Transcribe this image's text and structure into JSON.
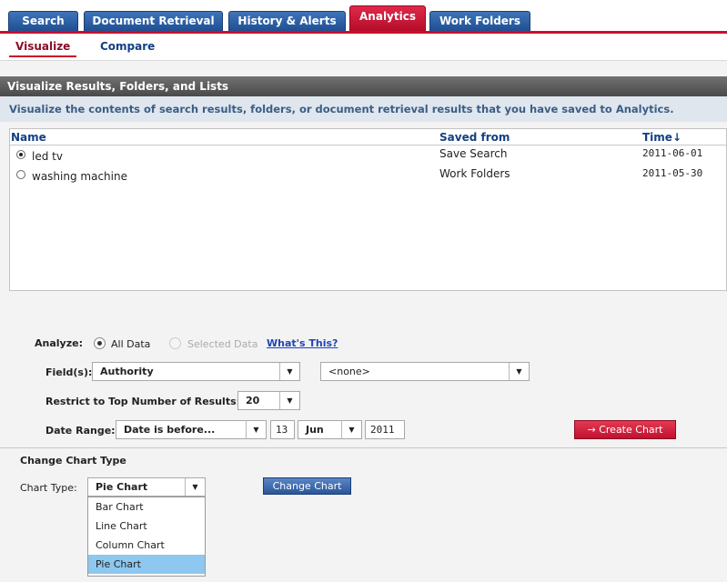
{
  "tabs": [
    {
      "label": "Search"
    },
    {
      "label": "Document Retrieval"
    },
    {
      "label": "History & Alerts"
    },
    {
      "label": "Analytics"
    },
    {
      "label": "Work Folders"
    }
  ],
  "subnav": {
    "visualize": "Visualize",
    "compare": "Compare"
  },
  "panel": {
    "title": "Visualize Results, Folders, and Lists",
    "description": "Visualize the contents of search results, folders, or document retrieval results that you have saved to Analytics."
  },
  "list": {
    "columns": {
      "name": "Name",
      "saved_from": "Saved from",
      "time": "Time↓"
    },
    "rows": [
      {
        "name": "led tv",
        "saved_from": "Save Search",
        "time": "2011-06-01"
      },
      {
        "name": "washing machine",
        "saved_from": "Work Folders",
        "time": "2011-05-30"
      }
    ]
  },
  "analyze": {
    "label": "Analyze:",
    "all_data": "All Data",
    "selected_data": "Selected Data",
    "whats_this": "What's This?"
  },
  "fields": {
    "label": "Field(s):",
    "field1": "Authority",
    "field2": "<none>"
  },
  "restrict": {
    "label": "Restrict to Top Number of Results:",
    "value": "20"
  },
  "date_range": {
    "label": "Date Range:",
    "mode": "Date is before...",
    "day": "13",
    "month": "Jun",
    "year": "2011"
  },
  "create_chart": "→ Create Chart",
  "change_chart": {
    "heading": "Change Chart Type",
    "label": "Chart Type:",
    "selected": "Pie Chart",
    "button": "Change Chart",
    "options": [
      "Bar Chart",
      "Line Chart",
      "Column Chart",
      "Pie Chart"
    ]
  },
  "colors": {
    "brand_red": "#c8102e",
    "tab_blue": "#1f4f93",
    "highlight": "#8ec7ef"
  }
}
